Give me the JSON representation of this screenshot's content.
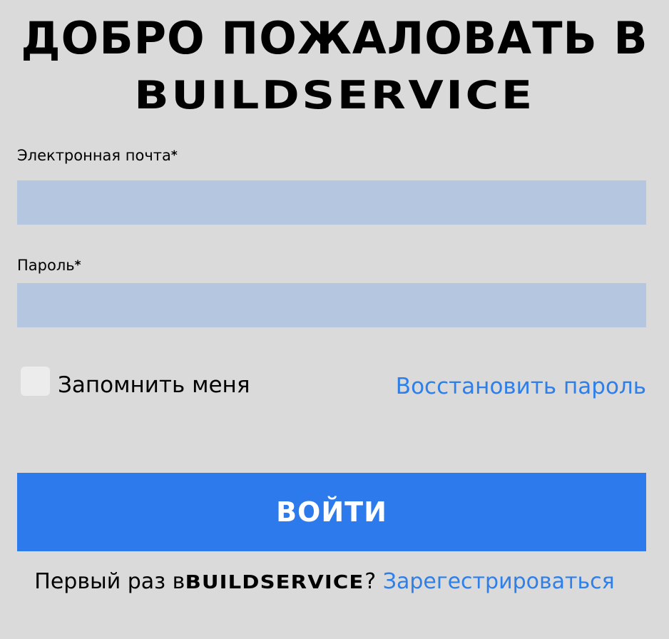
{
  "header": {
    "title_line1": "ДОБРО ПОЖАЛОВАТЬ В",
    "title_line2": "BUILDSERVICE"
  },
  "form": {
    "email": {
      "label": "Электронная почта",
      "required_mark": "*",
      "value": "",
      "placeholder": ""
    },
    "password": {
      "label": "Пароль",
      "required_mark": "*",
      "value": "",
      "placeholder": ""
    },
    "remember_me": {
      "label": "Запомнить меня",
      "checked": false
    },
    "forgot_password_link": "Восстановить пароль",
    "submit_label": "ВОЙТИ"
  },
  "footer": {
    "prompt_text": "Первый раз в",
    "brand": "BUILDSERVICE",
    "question_mark": "?",
    "signup_link": "Зарегестрироваться"
  },
  "colors": {
    "background": "#dadada",
    "input_background": "#b5c6e0",
    "accent_button": "#2c7aec",
    "link": "#2f7fea",
    "checkbox_fill": "#ececec"
  }
}
